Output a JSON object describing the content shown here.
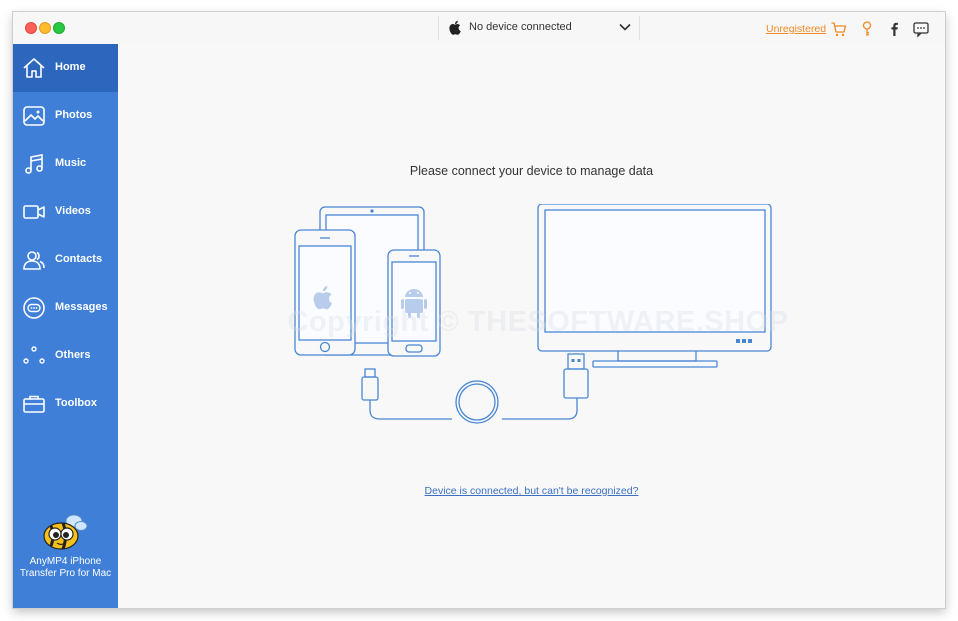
{
  "titlebar": {
    "device_label": "No device connected",
    "unregistered_label": "Unregistered"
  },
  "sidebar": {
    "items": [
      {
        "label": "Home",
        "icon": "home-icon"
      },
      {
        "label": "Photos",
        "icon": "photos-icon"
      },
      {
        "label": "Music",
        "icon": "music-icon"
      },
      {
        "label": "Videos",
        "icon": "videos-icon"
      },
      {
        "label": "Contacts",
        "icon": "contacts-icon"
      },
      {
        "label": "Messages",
        "icon": "messages-icon"
      },
      {
        "label": "Others",
        "icon": "others-icon"
      },
      {
        "label": "Toolbox",
        "icon": "toolbox-icon"
      }
    ],
    "active_index": 0,
    "brand_name": "AnyMP4 iPhone Transfer Pro for Mac"
  },
  "main": {
    "prompt": "Please connect your device to manage data",
    "help_link": "Device is connected, but can't be recognized?",
    "watermark": "Copyright © THESOFTWARE.SHOP"
  },
  "colors": {
    "sidebar": "#3f7fd8",
    "sidebar_active": "#2c66bd",
    "accent_orange": "#f08a24",
    "illustration_stroke": "#4a86d6",
    "link": "#3a6fc2"
  }
}
